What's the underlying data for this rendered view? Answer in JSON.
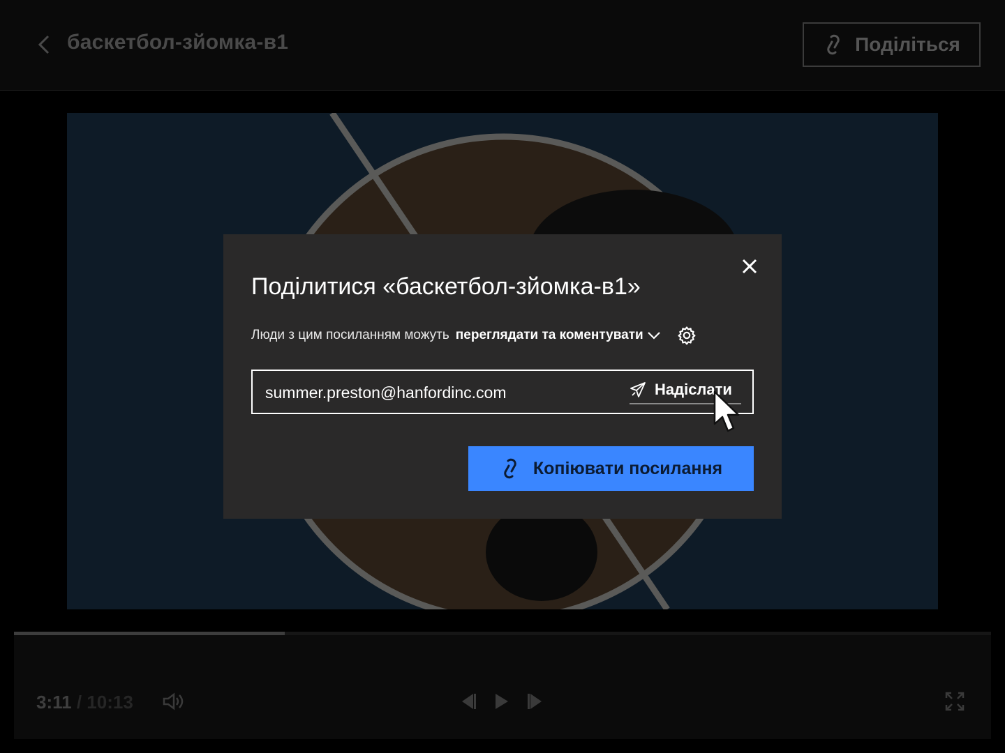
{
  "header": {
    "title": "баскетбол-зйомка-в1",
    "share_label": "Поділіться"
  },
  "player": {
    "current_time": "3:11",
    "separator": " / ",
    "duration": "10:13",
    "progress": 0.277
  },
  "dialog": {
    "title": "Поділитися «баскетбол-зйомка-в1»",
    "permission_prefix": "Люди з цим посиланням можуть",
    "permission_value": "переглядати та коментувати",
    "email_value": "summer.preston@hanfordinc.com",
    "send_label": "Надіслати",
    "copy_link_label": "Копіювати посилання"
  },
  "colors": {
    "accent": "#3a86ff",
    "modal_bg": "#2a2929"
  },
  "icons": [
    "chevron-left-icon",
    "link-icon",
    "close-icon",
    "chevron-down-icon",
    "gear-icon",
    "send-icon",
    "volume-icon",
    "skip-back-icon",
    "play-icon",
    "skip-forward-icon",
    "fullscreen-icon",
    "mouse-pointer-icon"
  ]
}
